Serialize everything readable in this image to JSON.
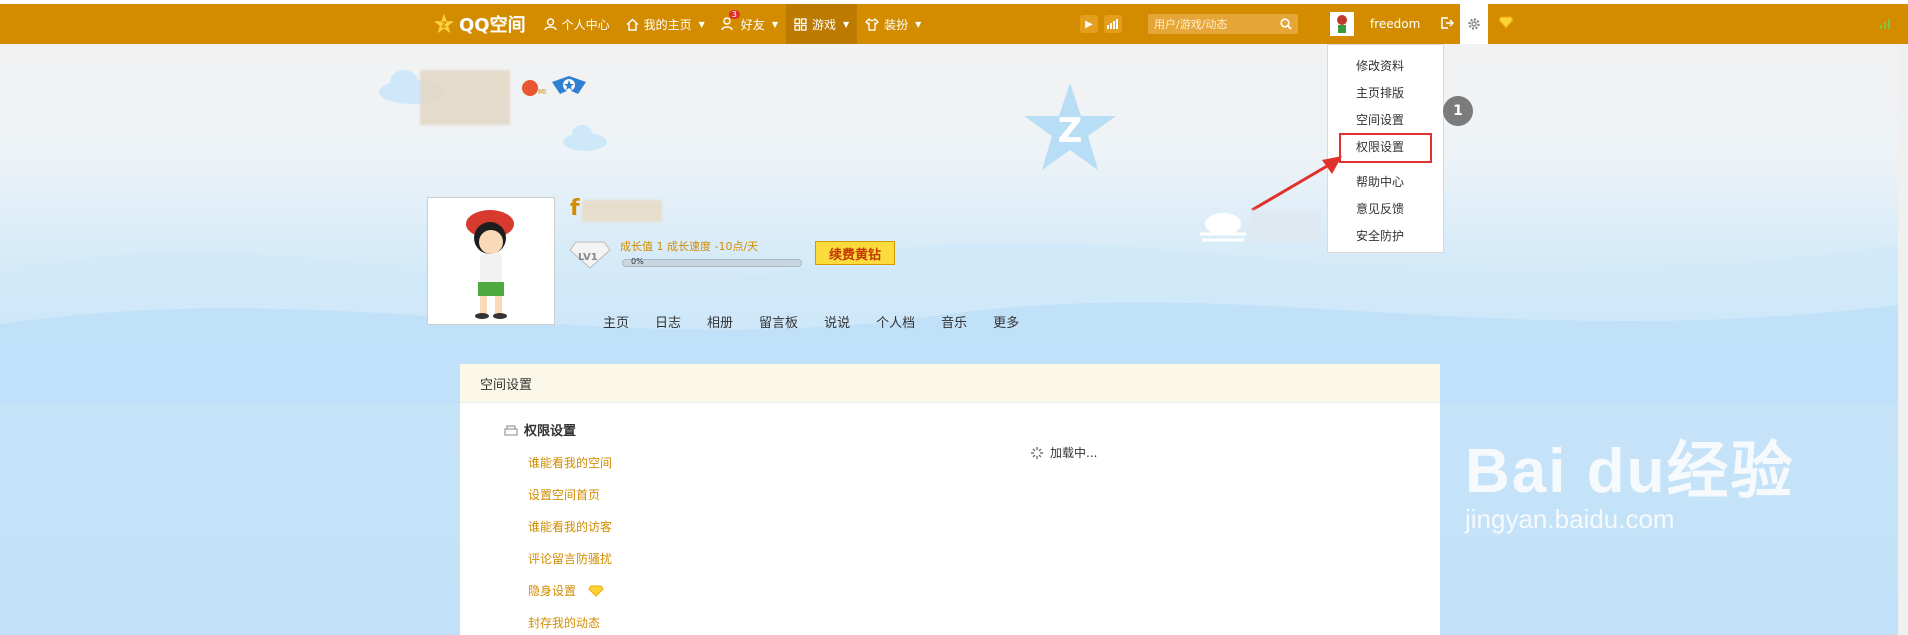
{
  "topbar": {
    "logo_text": "QQ空间",
    "nav": [
      {
        "label": "个人中心",
        "icon": "user-icon",
        "caret": false
      },
      {
        "label": "我的主页",
        "icon": "home-icon",
        "caret": true
      },
      {
        "label": "好友",
        "icon": "friends-icon",
        "caret": true,
        "badge": "3"
      },
      {
        "label": "游戏",
        "icon": "grid-icon",
        "caret": true
      },
      {
        "label": "装扮",
        "icon": "shirt-icon",
        "caret": true
      }
    ],
    "search_placeholder": "用户/游戏/动态",
    "username": "freedom"
  },
  "settings_menu": {
    "items": [
      "修改资料",
      "主页排版",
      "空间设置",
      "权限设置",
      "帮助中心",
      "意见反馈",
      "安全防护"
    ],
    "highlighted": "权限设置"
  },
  "profile": {
    "nickname": "f",
    "level": "LV1",
    "growth_text": "成长值 1  成长速度 -10点/天",
    "progress_label": "0%",
    "progress_value": 0,
    "renew_button": "续费黄钻",
    "notification_count": "1"
  },
  "tabs": [
    "主页",
    "日志",
    "相册",
    "留言板",
    "说说",
    "个人档",
    "音乐",
    "更多"
  ],
  "panel": {
    "title": "空间设置",
    "section_title": "权限设置",
    "links": [
      "谁能看我的空间",
      "设置空间首页",
      "谁能看我的访客",
      "评论留言防骚扰",
      "隐身设置",
      "封存我的动态"
    ],
    "loading_text": "加载中..."
  },
  "watermark": {
    "line1": "Bai du经验",
    "line2": "jingyan.baidu.com"
  },
  "colors": {
    "topbar": "#d38c00",
    "accent": "#d38c00",
    "highlight": "#e0312b"
  }
}
